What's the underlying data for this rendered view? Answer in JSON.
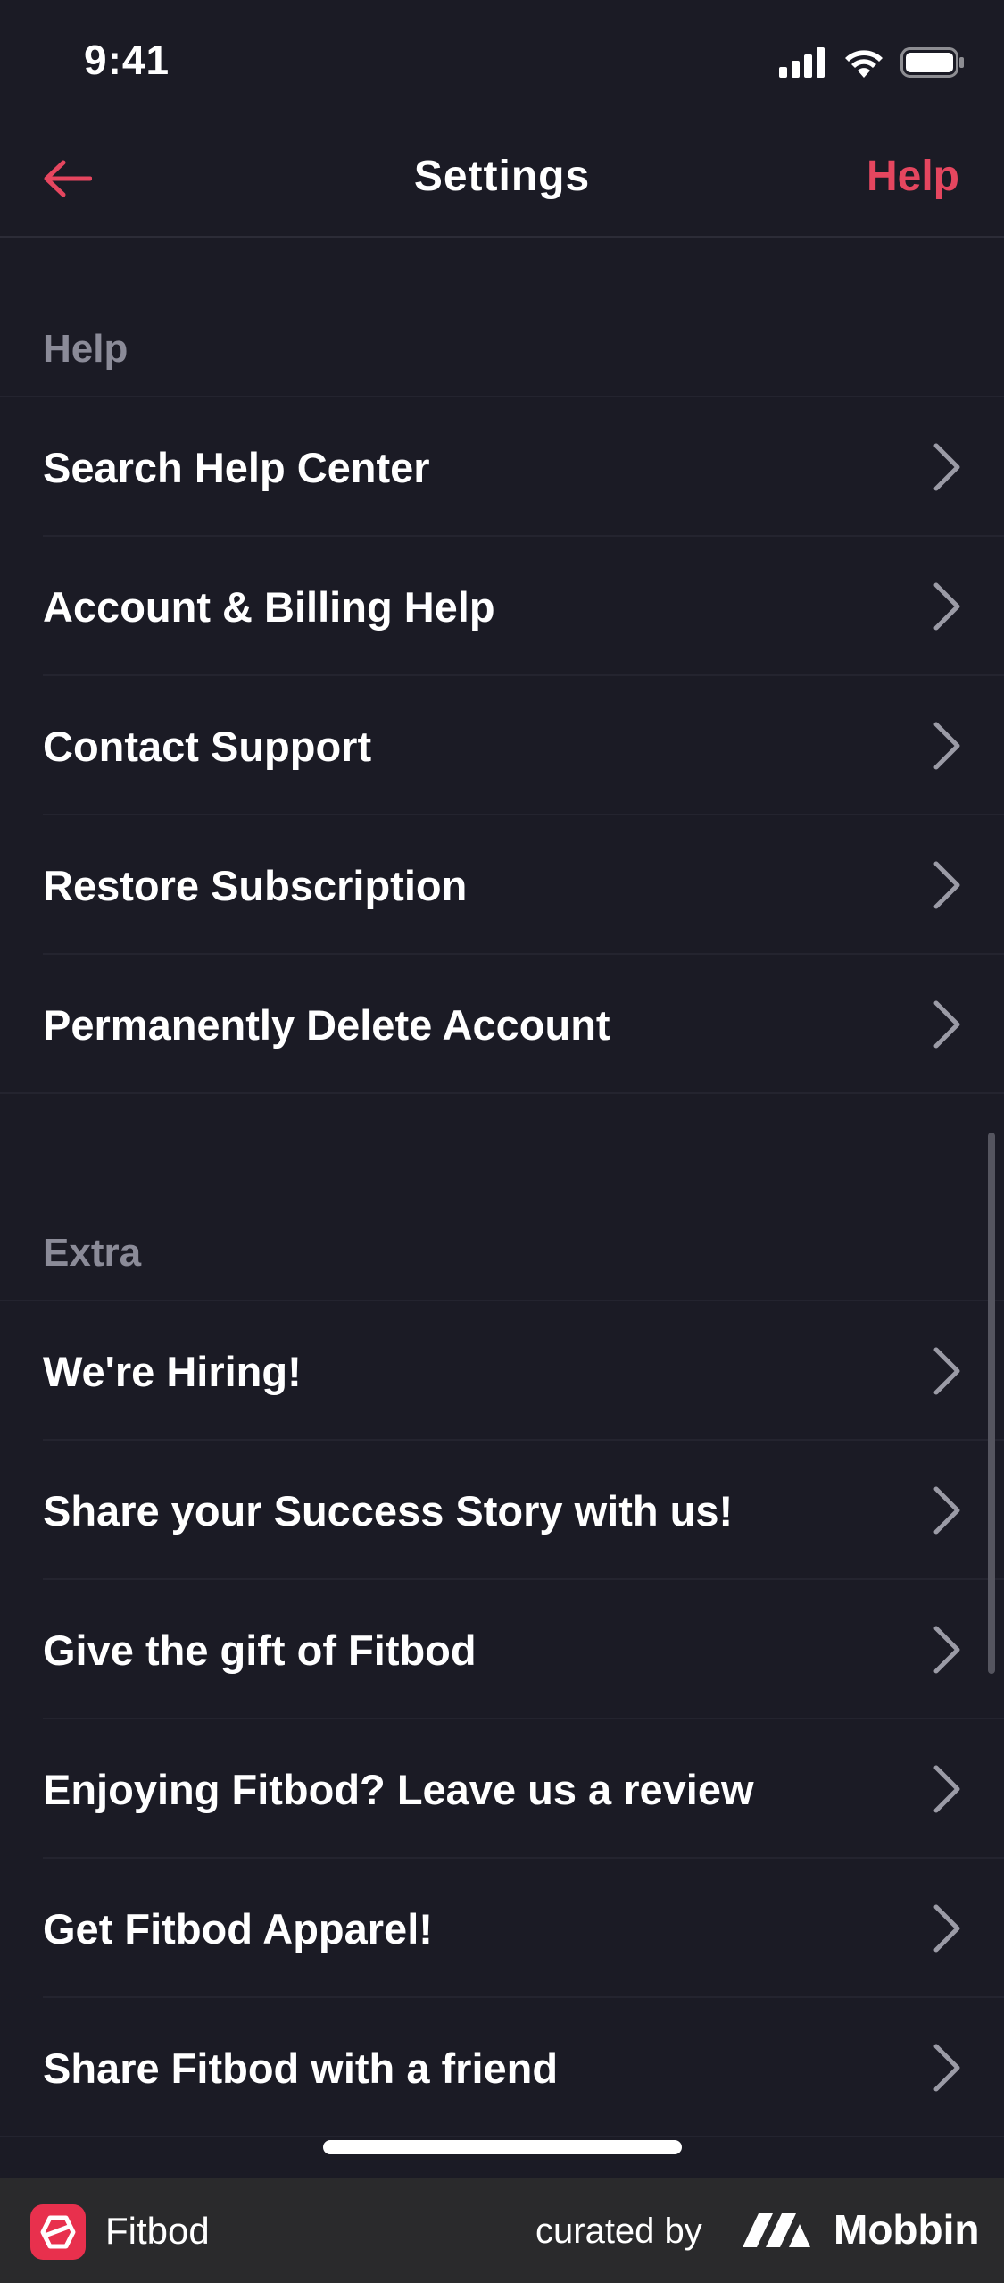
{
  "status_bar": {
    "time": "9:41",
    "icons": [
      "signal-icon",
      "wifi-icon",
      "battery-icon"
    ]
  },
  "nav": {
    "back_icon": "arrow-left-icon",
    "title": "Settings",
    "help_label": "Help"
  },
  "sections": [
    {
      "header": "Help",
      "items": [
        {
          "label": "Search Help Center"
        },
        {
          "label": "Account & Billing Help"
        },
        {
          "label": "Contact Support"
        },
        {
          "label": "Restore Subscription"
        },
        {
          "label": "Permanently Delete Account"
        }
      ]
    },
    {
      "header": "Extra",
      "items": [
        {
          "label": "We're Hiring!"
        },
        {
          "label": "Share your Success Story with us!"
        },
        {
          "label": "Give the gift of Fitbod"
        },
        {
          "label": "Enjoying Fitbod? Leave us a review"
        },
        {
          "label": "Get Fitbod Apparel!"
        },
        {
          "label": "Share Fitbod with a friend"
        }
      ]
    }
  ],
  "footer": {
    "app_name": "Fitbod",
    "curated_label": "curated by",
    "brand_name": "Mobbin"
  },
  "colors": {
    "background": "#1b1b25",
    "accent": "#e5465f",
    "section_header": "#8b8b98"
  }
}
